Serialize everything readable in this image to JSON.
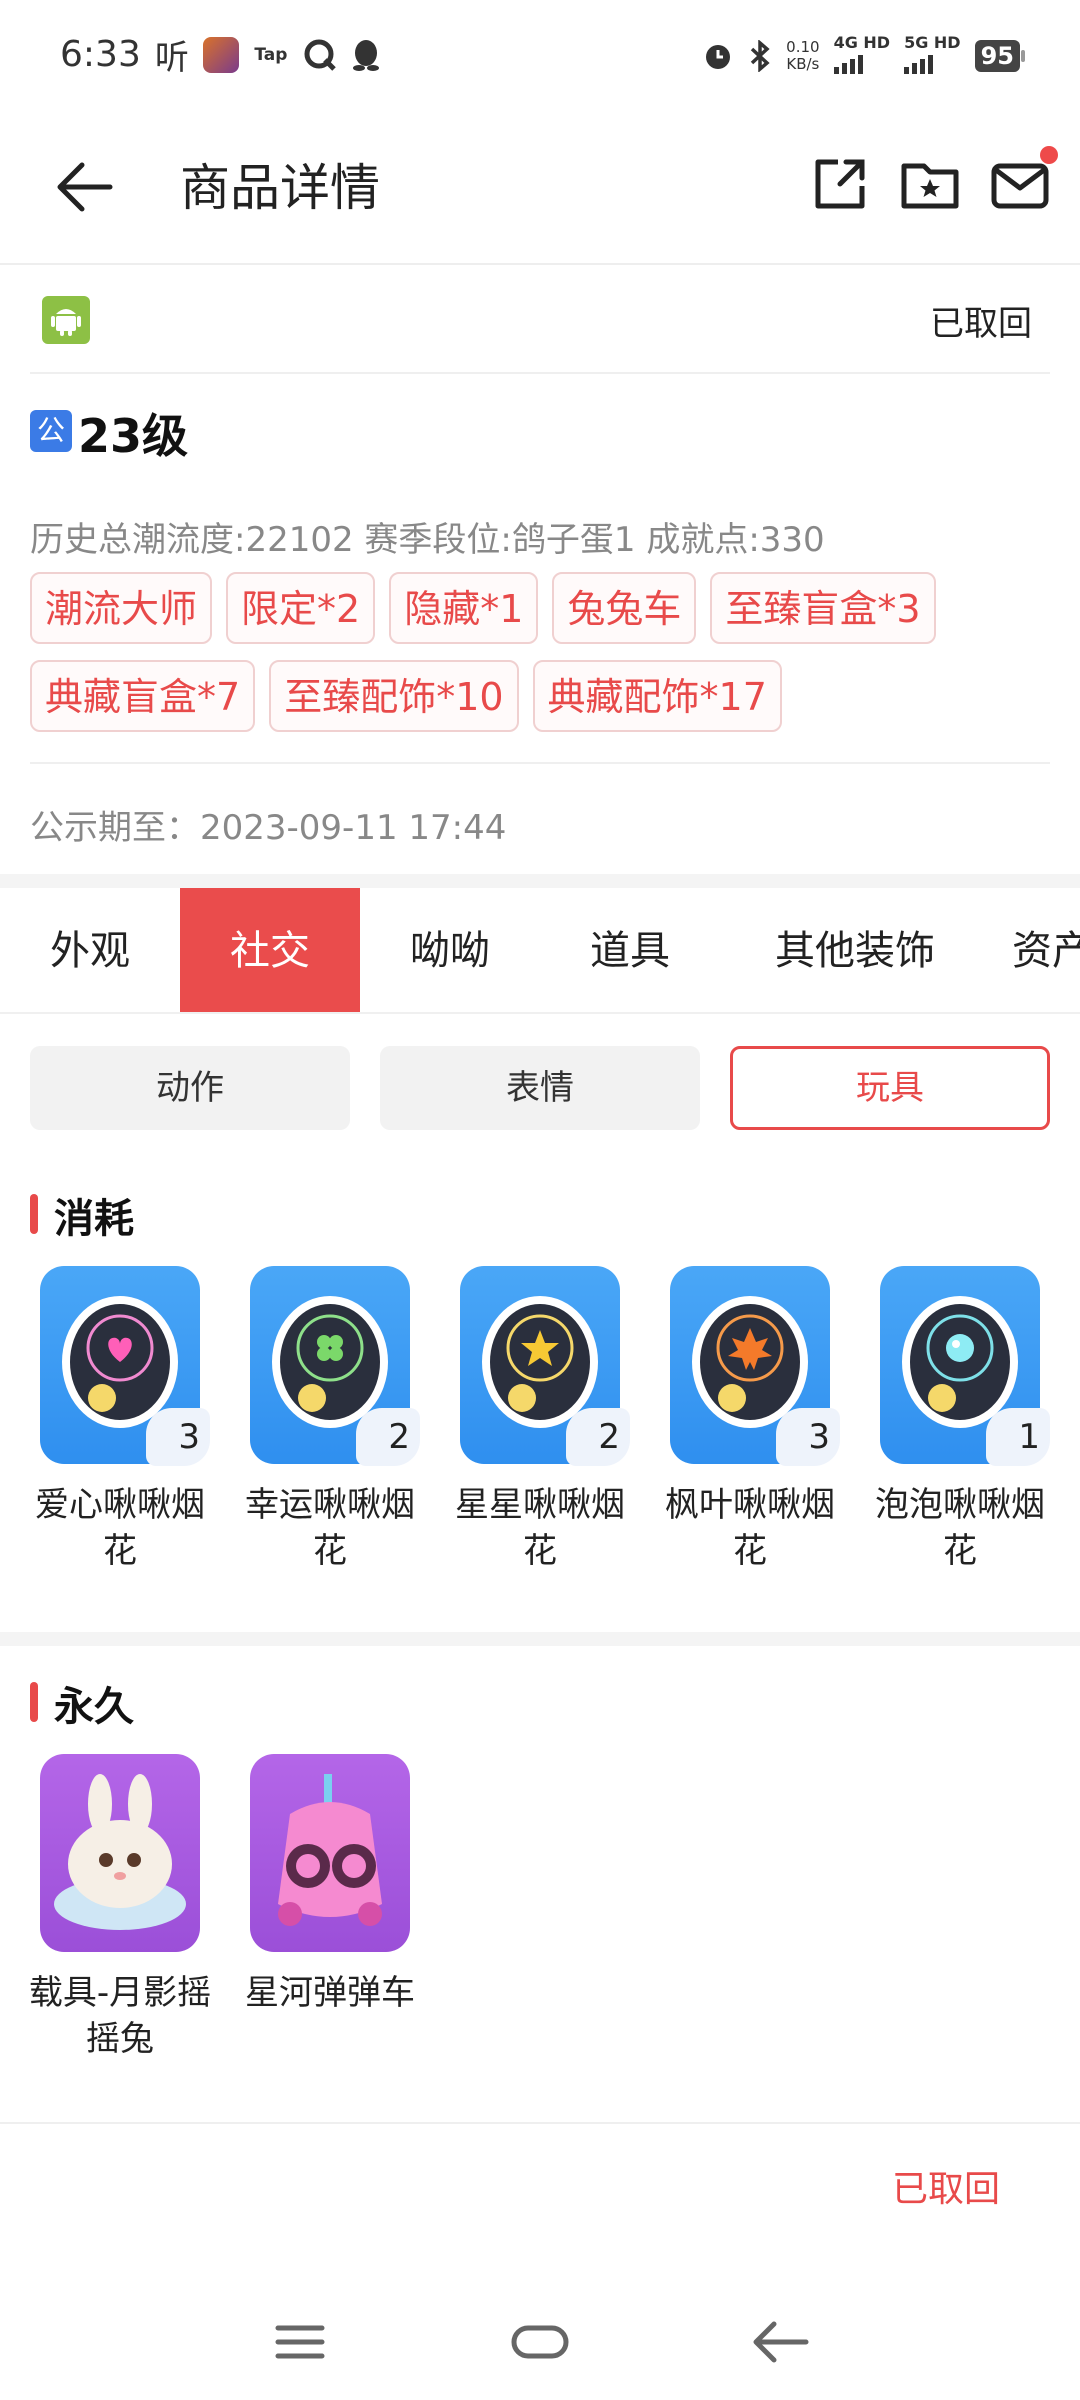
{
  "status_bar": {
    "time": "6:33",
    "ting": "听",
    "tap": "Tap",
    "speed_value": "0.10",
    "speed_unit": "KB/s",
    "net1": "4G HD",
    "net2": "5G HD",
    "battery": "95",
    "icons": [
      "game-app-icon",
      "tap-icon",
      "q-icon",
      "penguin-icon",
      "alarm-icon",
      "bluetooth-icon"
    ]
  },
  "header": {
    "title": "商品详情",
    "icons": [
      "back-arrow-icon",
      "share-icon",
      "favorite-folder-icon",
      "mail-icon"
    ],
    "notification_color": "#ee4a4a"
  },
  "info": {
    "platform_icon": "android-icon",
    "status": "已取回",
    "public_badge": "公",
    "level": "23级",
    "stats": "历史总潮流度:22102 赛季段位:鸽子蛋1 成就点:330",
    "tags": [
      "潮流大师",
      "限定*2",
      "隐藏*1",
      "兔兔车",
      "至臻盲盒*3",
      "典藏盲盒*7",
      "至臻配饰*10",
      "典藏配饰*17"
    ],
    "public_until": "公示期至：2023-09-11 17:44"
  },
  "tabs": [
    "外观",
    "社交",
    "呦呦",
    "道具",
    "其他装饰",
    "资产"
  ],
  "active_tab": "社交",
  "sub_tabs": [
    "动作",
    "表情",
    "玩具"
  ],
  "active_sub_tab": "玩具",
  "sections": [
    {
      "title": "消耗",
      "items": [
        {
          "name": "爱心啾啾烟花",
          "count": "3",
          "icon": "heart-firework-icon"
        },
        {
          "name": "幸运啾啾烟花",
          "count": "2",
          "icon": "clover-firework-icon"
        },
        {
          "name": "星星啾啾烟花",
          "count": "2",
          "icon": "star-firework-icon"
        },
        {
          "name": "枫叶啾啾烟花",
          "count": "3",
          "icon": "maple-firework-icon"
        },
        {
          "name": "泡泡啾啾烟花",
          "count": "1",
          "icon": "bubble-firework-icon"
        }
      ]
    },
    {
      "title": "永久",
      "items": [
        {
          "name": "载具-月影摇摇兔",
          "icon": "moon-rabbit-vehicle-icon"
        },
        {
          "name": "星河弹弹车",
          "icon": "galaxy-bounce-car-icon"
        }
      ]
    }
  ],
  "bottom": {
    "status": "已取回"
  },
  "nav": [
    "menu-icon",
    "home-icon",
    "back-icon"
  ],
  "colors": {
    "accent": "#e84a4a",
    "item_blue": "#3b9bf5",
    "item_purple": "#a858e0",
    "android": "#8dc045",
    "public_badge": "#3b7be6"
  }
}
